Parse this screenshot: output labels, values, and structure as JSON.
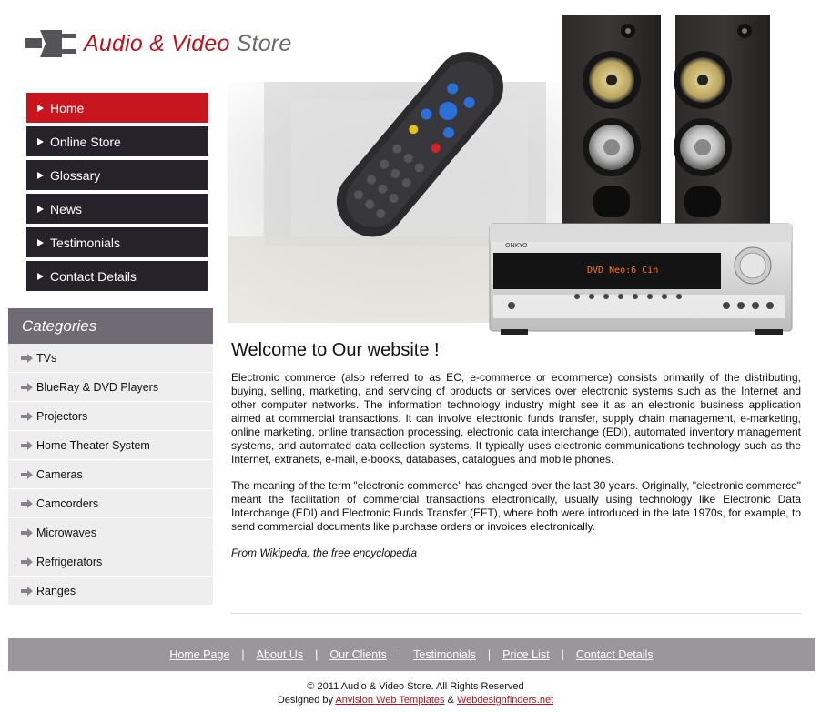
{
  "brand": {
    "accent": "Audio & Video",
    "rest": " Store",
    "accent_color": "#c0121e",
    "rest_color": "#6a6870",
    "icon": "plug-icon"
  },
  "nav": {
    "items": [
      {
        "label": "Home",
        "active": true
      },
      {
        "label": "Online Store"
      },
      {
        "label": "Glossary"
      },
      {
        "label": "News"
      },
      {
        "label": "Testimonials"
      },
      {
        "label": "Contact Details"
      }
    ],
    "active_color": "#c8161f",
    "item_color": "#25222a"
  },
  "hero": {
    "receiver_display": "DVD Neo:6 Cin",
    "receiver_brand": "ONKYO"
  },
  "categories": {
    "heading": "Categories",
    "items": [
      "TVs",
      "BlueRay & DVD Players",
      "Projectors",
      "Home Theater System",
      "Cameras",
      "Camcorders",
      "Microwaves",
      "Refrigerators",
      "Ranges"
    ]
  },
  "content": {
    "title": "Welcome to Our website !",
    "paragraphs": [
      "Electronic commerce (also referred to as EC, e-commerce or ecommerce) consists primarily of the distributing, buying, selling, marketing, and servicing of products or services over electronic systems such as the Internet and other computer networks. The information technology industry might see it as an electronic business application aimed at commercial transactions. It can involve electronic funds transfer, supply chain management, e-marketing, online marketing, online transaction processing, electronic data interchange (EDI), automated inventory management systems, and automated data collection systems. It typically uses electronic communications technology such as the Internet, extranets, e-mail, e-books, databases, catalogues and mobile phones.",
      "The meaning of the term \"electronic commerce\" has changed over the last 30 years. Originally, \"electronic commerce\" meant the facilitation of commercial transactions electronically, usually using technology like Electronic Data Interchange (EDI) and Electronic Funds Transfer (EFT), where both were introduced in the late 1970s, for example, to send commercial documents like purchase orders or invoices electronically."
    ],
    "source": "From Wikipedia, the free encyclopedia"
  },
  "footer": {
    "links": [
      "Home Page",
      "About Us",
      "Our Clients",
      "Testimonials",
      "Price List",
      "Contact Details"
    ],
    "separator": "|",
    "copyright": "© 2011 Audio & Video Store. All Rights Reserved",
    "designed_by": "Designed by ",
    "designer1": "Anvision Web Templates",
    "amp": " & ",
    "designer2": "Webdesignfinders.net"
  }
}
